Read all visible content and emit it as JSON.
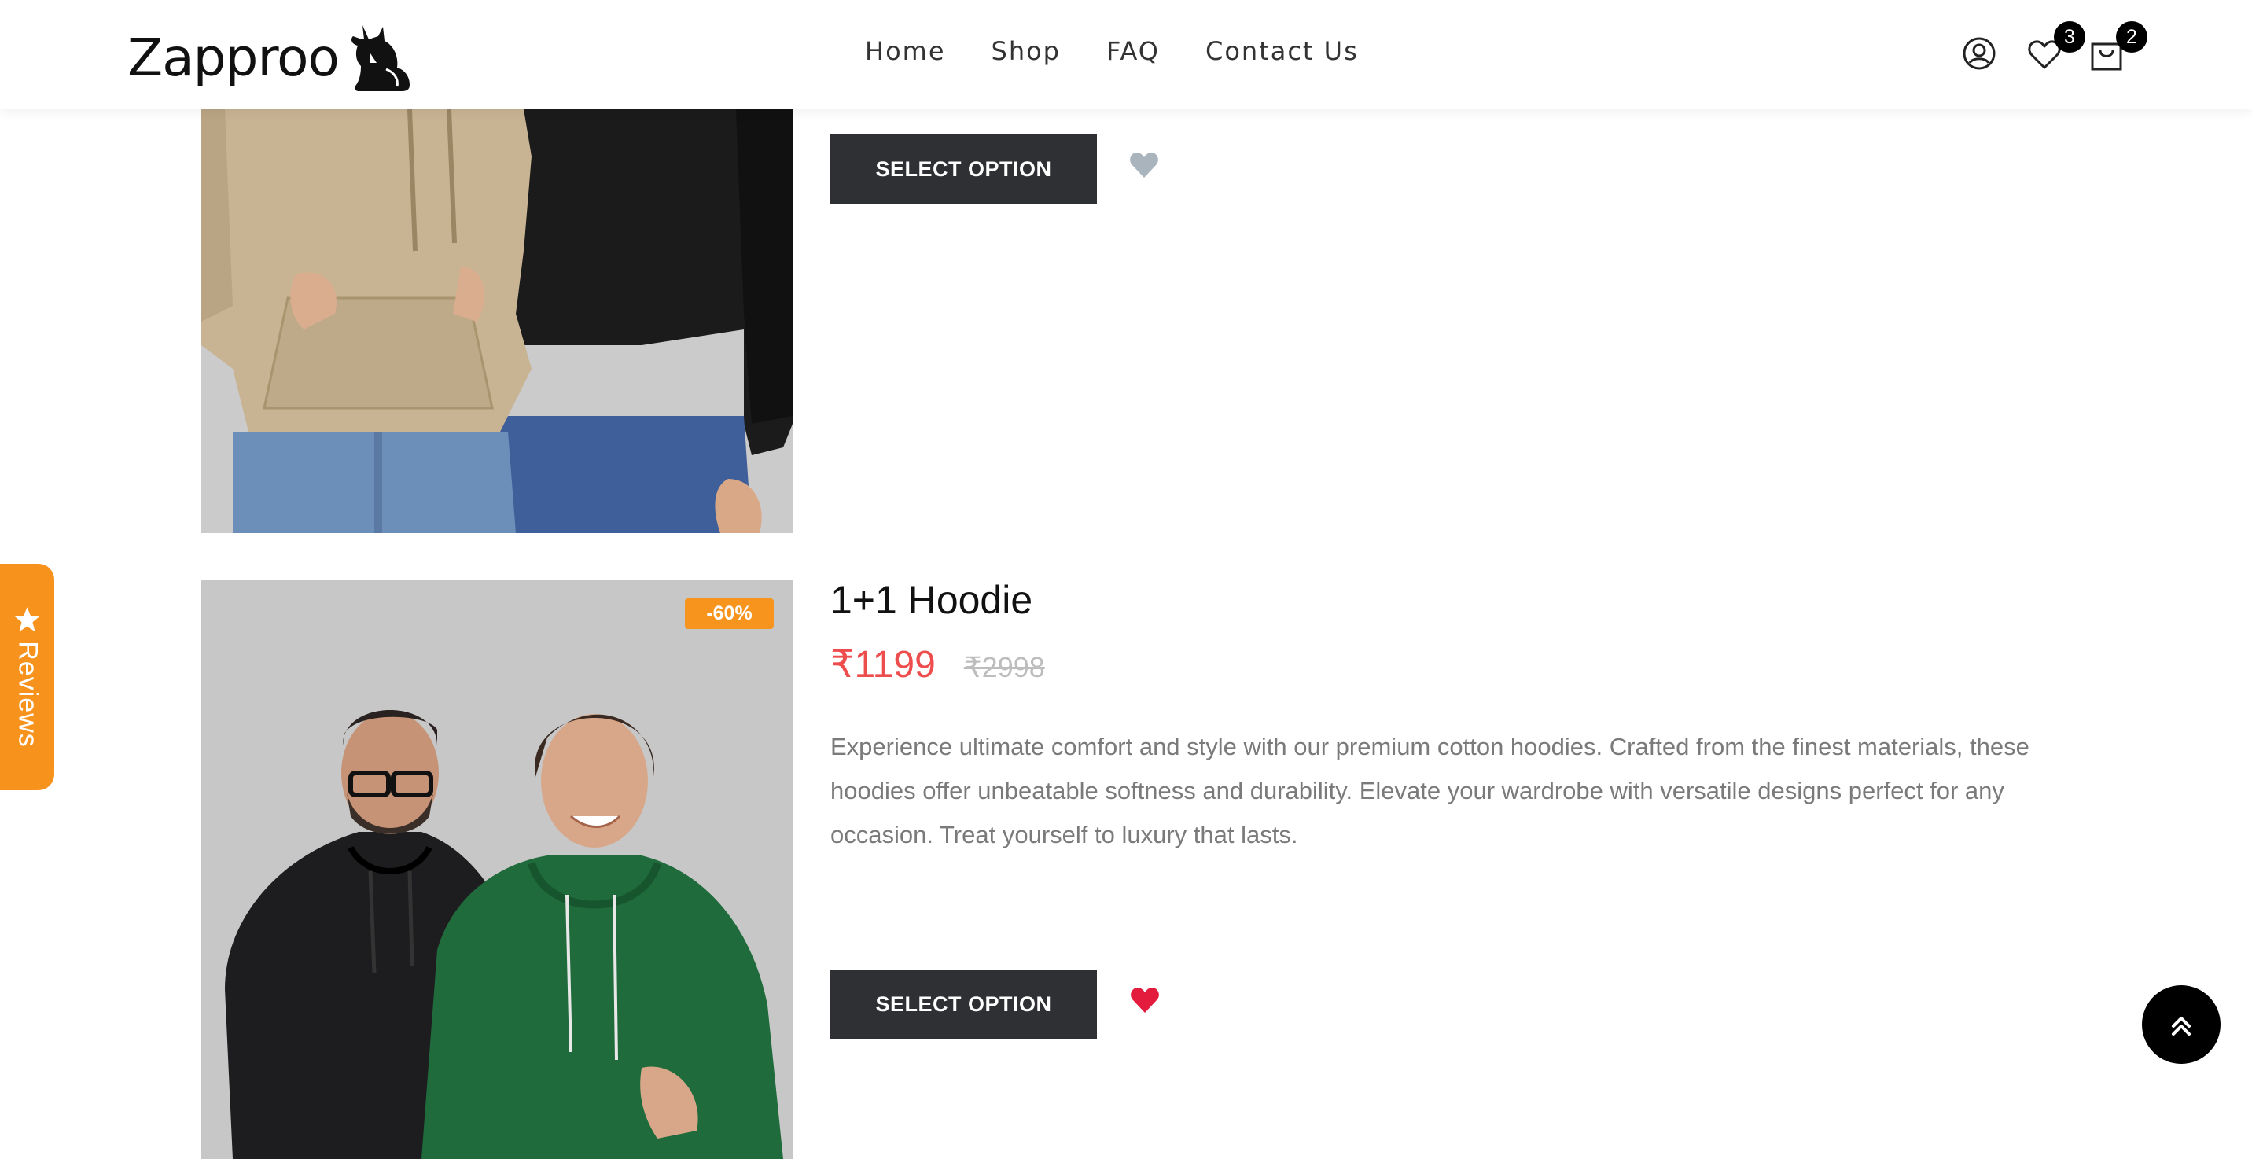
{
  "header": {
    "logo_text": "Zapproo",
    "nav": [
      "Home",
      "Shop",
      "FAQ",
      "Contact Us"
    ],
    "wishlist_count": "3",
    "cart_count": "2",
    "icons": [
      "account-icon",
      "heart-outline-icon",
      "shopping-bag-icon"
    ]
  },
  "products": [
    {
      "select_label": "SELECT OPTION",
      "wishlist_active": false,
      "wishlist_color": "#a9b4bd"
    },
    {
      "title": "1+1 Hoodie",
      "discount": "-60%",
      "price": "₹1199",
      "old_price": "₹2998",
      "description": "Experience ultimate comfort and style with our premium cotton hoodies. Crafted from the finest materials, these hoodies offer unbeatable softness and durability. Elevate your wardrobe with versatile designs perfect for any occasion. Treat yourself to luxury that lasts.",
      "select_label": "SELECT OPTION",
      "wishlist_active": true,
      "wishlist_color": "#e31b3c"
    }
  ],
  "reviews_tab": {
    "label": "Reviews",
    "icon": "star-icon"
  },
  "scroll_top_icon": "double-chevron-up-icon",
  "colors": {
    "accent_orange": "#f7931d",
    "price_red": "#ee4d4d",
    "button_dark": "#2f3034"
  }
}
